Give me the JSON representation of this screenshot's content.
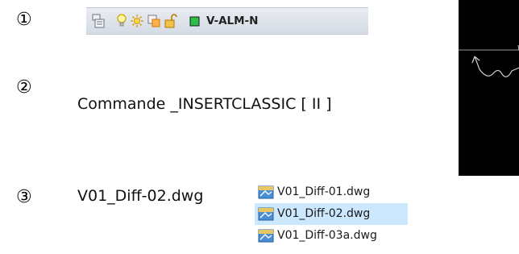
{
  "steps": {
    "n1": "①",
    "n2": "②",
    "n3": "③"
  },
  "layer_toolbar": {
    "layer_name": "V-ALM-N",
    "icons": [
      "layer-manager-icon",
      "lightbulb-icon",
      "sun-icon",
      "freeze-vp-icon",
      "unlock-icon",
      "color-swatch-icon"
    ]
  },
  "command": {
    "text": "Commande _INSERTCLASSIC  [ II ]"
  },
  "file": {
    "current": "V01_Diff-02.dwg"
  },
  "file_list": {
    "items": [
      {
        "name": "V01_Diff-01.dwg",
        "selected": false
      },
      {
        "name": "V01_Diff-02.dwg",
        "selected": true
      },
      {
        "name": "V01_Diff-03a.dwg",
        "selected": false
      }
    ]
  },
  "colors": {
    "toolbar_bg": "#dde2ea",
    "selection": "#cce8ff",
    "viewport": "#000000",
    "swatch_green": "#2bbf4a"
  }
}
